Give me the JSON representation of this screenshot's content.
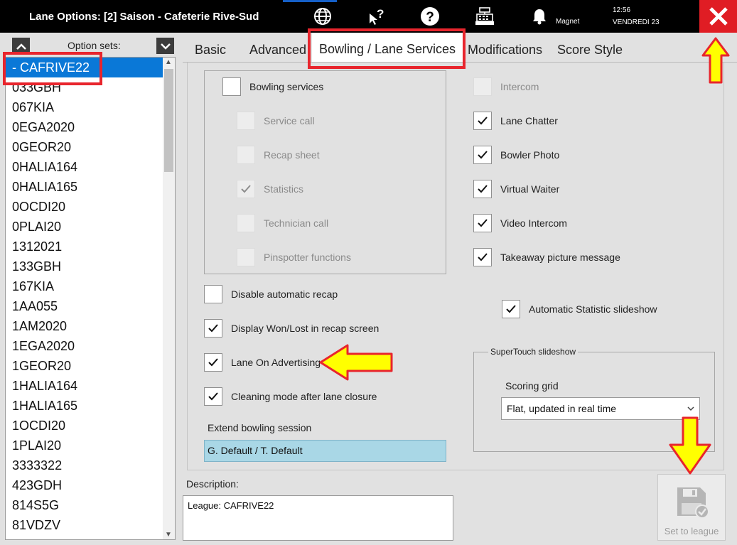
{
  "window": {
    "title": "Lane Options: [2] Saison - Cafeterie Rive-Sud",
    "status_label": "Magnet",
    "time": "12:56",
    "date": "VENDREDI 23"
  },
  "icons": [
    "globe-icon",
    "pointer-help-icon",
    "help-icon",
    "cash-register-icon",
    "bell-icon",
    "close-icon"
  ],
  "sidebar": {
    "label": "Option sets:",
    "items": [
      {
        "label": "- CAFRIVE22",
        "selected": true
      },
      {
        "label": "033GBH"
      },
      {
        "label": "067KIA"
      },
      {
        "label": "0EGA2020"
      },
      {
        "label": "0GEOR20"
      },
      {
        "label": "0HALIA164"
      },
      {
        "label": "0HALIA165"
      },
      {
        "label": "0OCDI20"
      },
      {
        "label": "0PLAI20"
      },
      {
        "label": "1312021"
      },
      {
        "label": "133GBH"
      },
      {
        "label": "167KIA"
      },
      {
        "label": "1AA055"
      },
      {
        "label": "1AM2020"
      },
      {
        "label": "1EGA2020"
      },
      {
        "label": "1GEOR20"
      },
      {
        "label": "1HALIA164"
      },
      {
        "label": "1HALIA165"
      },
      {
        "label": "1OCDI20"
      },
      {
        "label": "1PLAI20"
      },
      {
        "label": "3333322"
      },
      {
        "label": "423GDH"
      },
      {
        "label": "814S5G"
      },
      {
        "label": "81VDZV"
      }
    ]
  },
  "tabs": [
    {
      "label": "Basic"
    },
    {
      "label": "Advanced"
    },
    {
      "label": "Bowling / Lane Services",
      "active": true
    },
    {
      "label": "Modifications"
    },
    {
      "label": "Score Style"
    }
  ],
  "bowling_services": {
    "label": "Bowling services",
    "checked": false,
    "sub_items": [
      {
        "label": "Service call",
        "checked": false,
        "enabled": false
      },
      {
        "label": "Recap sheet",
        "checked": false,
        "enabled": false
      },
      {
        "label": "Statistics",
        "checked": true,
        "enabled": false
      },
      {
        "label": "Technician call",
        "checked": false,
        "enabled": false
      },
      {
        "label": "Pinspotter functions",
        "checked": false,
        "enabled": false
      }
    ]
  },
  "left_options": [
    {
      "label": "Disable automatic recap",
      "checked": false
    },
    {
      "label": "Display Won/Lost in recap screen",
      "checked": true
    },
    {
      "label": "Lane On Advertising",
      "checked": true
    },
    {
      "label": "Cleaning mode after lane closure",
      "checked": true
    }
  ],
  "extend_session": {
    "label": "Extend bowling session",
    "value": "G. Default / T. Default"
  },
  "right_options": [
    {
      "label": "Intercom",
      "checked": false,
      "enabled": false
    },
    {
      "label": "Lane Chatter",
      "checked": true,
      "enabled": true
    },
    {
      "label": "Bowler Photo",
      "checked": true,
      "enabled": true
    },
    {
      "label": "Virtual Waiter",
      "checked": true,
      "enabled": true
    },
    {
      "label": "Video Intercom",
      "checked": true,
      "enabled": true
    },
    {
      "label": "Takeaway picture message",
      "checked": true,
      "enabled": true
    }
  ],
  "auto_stat_slideshow": {
    "label": "Automatic Statistic slideshow",
    "checked": true
  },
  "supertouch": {
    "legend": "SuperTouch slideshow",
    "scoring_label": "Scoring grid",
    "scoring_value": "Flat, updated in real time"
  },
  "description": {
    "label": "Description:",
    "value": "League: CAFRIVE22"
  },
  "set_league": {
    "label": "Set to league",
    "enabled": false
  },
  "colors": {
    "accent": "#0a78d7",
    "close_bg": "#e01d24",
    "annotation_red": "#e8252d",
    "annotation_yellow": "#ffff00",
    "field_blue": "#a9d7e6"
  }
}
